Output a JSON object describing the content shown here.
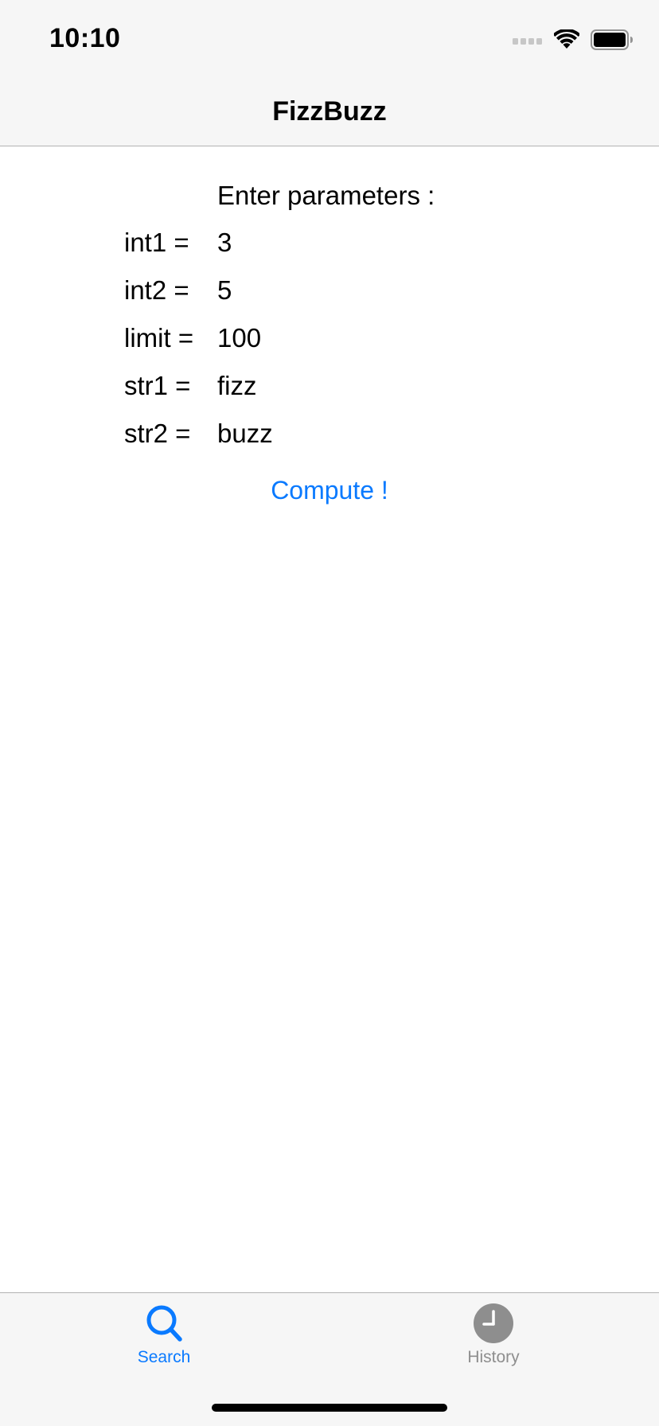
{
  "status_bar": {
    "time": "10:10"
  },
  "nav": {
    "title": "FizzBuzz"
  },
  "form": {
    "heading": "Enter parameters :",
    "params": [
      {
        "label": "int1 =",
        "value": "3"
      },
      {
        "label": "int2 =",
        "value": "5"
      },
      {
        "label": "limit =",
        "value": "100"
      },
      {
        "label": "str1 =",
        "value": "fizz"
      },
      {
        "label": "str2 =",
        "value": "buzz"
      }
    ],
    "compute_label": "Compute !"
  },
  "tabs": [
    {
      "label": "Search",
      "icon": "search-icon",
      "selected": true
    },
    {
      "label": "History",
      "icon": "clock-icon",
      "selected": false
    }
  ],
  "colors": {
    "accent": "#0a7aff",
    "inactive_tab": "#8e8e8e",
    "bar_background": "#f6f6f6"
  }
}
